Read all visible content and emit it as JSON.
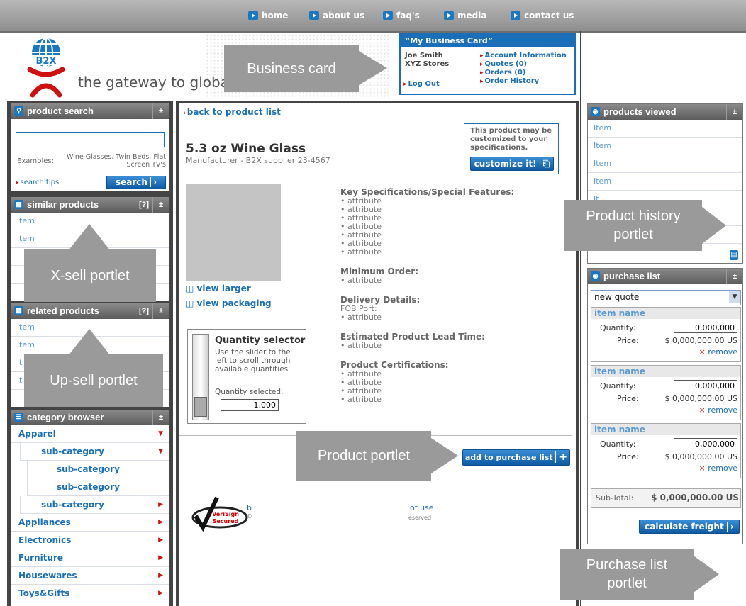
{
  "nav": {
    "items": [
      "home",
      "about us",
      "faq's",
      "media",
      "contact us"
    ]
  },
  "header": {
    "tagline": "the gateway to globa",
    "logo_text": "B2X"
  },
  "business_card": {
    "title": "“My Business Card”",
    "user_name": "Joe Smith",
    "company": "XYZ Stores",
    "logout": "Log Out",
    "links": [
      "Account Information",
      "Quotes (0)",
      "Orders (0)",
      "Order History"
    ]
  },
  "product_search": {
    "title": "product search",
    "examples_label": "Examples:",
    "examples_text": "Wine Glasses, Twin Beds, Flat Screen TV's",
    "tips": "search tips",
    "button": "search"
  },
  "similar_products": {
    "title": "similar products",
    "help": "[?]",
    "items": [
      "item",
      "item",
      "i",
      "i"
    ]
  },
  "related_products": {
    "title": "related products",
    "help": "[?]",
    "items": [
      "item",
      "item",
      "it",
      "it"
    ]
  },
  "category_browser": {
    "title": "category browser",
    "items": [
      {
        "label": "Apparel",
        "level": 0,
        "state": "open"
      },
      {
        "label": "sub-category",
        "level": 1,
        "state": "open"
      },
      {
        "label": "sub-category",
        "level": 2,
        "state": "none"
      },
      {
        "label": "sub-category",
        "level": 2,
        "state": "none"
      },
      {
        "label": "sub-category",
        "level": 1,
        "state": "closed"
      },
      {
        "label": "Appliances",
        "level": 0,
        "state": "closed"
      },
      {
        "label": "Electronics",
        "level": 0,
        "state": "closed"
      },
      {
        "label": "Furniture",
        "level": 0,
        "state": "closed"
      },
      {
        "label": "Housewares",
        "level": 0,
        "state": "closed"
      },
      {
        "label": "Toys&Gifts",
        "level": 0,
        "state": "closed"
      }
    ]
  },
  "product": {
    "back_link": "back to product list",
    "name": "5.3 oz Wine Glass",
    "manufacturer": "Manufacturer - B2X supplier 23-4567",
    "customize_note": "This product may be customized to your specifications.",
    "customize_button": "customize it!",
    "view_larger": "view larger",
    "view_packaging": "view packaging",
    "quantity_title": "Quantity selector",
    "quantity_desc": "Use the slider to the left to scroll through available quantities",
    "quantity_selected_label": "Quantity selected:",
    "quantity_value": "1,000",
    "specs": [
      {
        "heading": "Key Specifications/Special Features:",
        "lines": [
          "• attribute",
          "• attribute",
          "• attribute",
          "• attribute",
          "• attribute",
          "• attribute",
          "• attribute"
        ]
      },
      {
        "heading": "Minimum Order:",
        "lines": [
          "• attribute"
        ]
      },
      {
        "heading": "Delivery Details:",
        "lines": [
          "FOB Port:",
          "• attribute"
        ]
      },
      {
        "heading": "Estimated Product Lead Time:",
        "lines": [
          "• attribute"
        ]
      },
      {
        "heading": "Product Certifications:",
        "lines": [
          "• attribute",
          "• attribute",
          "• attribute",
          "• attribute"
        ]
      }
    ],
    "add_button": "add to purchase list"
  },
  "footer": {
    "text1": "b",
    "text2": "of use",
    "text3": "©",
    "text4": "eserved",
    "verisign": [
      "VeriSign",
      "Secured"
    ]
  },
  "products_viewed": {
    "title": "products viewed",
    "items": [
      "Item",
      "Item",
      "Item",
      "Item",
      "It"
    ]
  },
  "purchase_list": {
    "title": "purchase list",
    "select_value": "new quote",
    "items": [
      {
        "name": "item name",
        "quantity_label": "Quantity:",
        "quantity": "0,000,000",
        "price_label": "Price:",
        "price": "$ 0,000,000.00 US",
        "remove": "remove"
      },
      {
        "name": "item name",
        "quantity_label": "Quantity:",
        "quantity": "0,000,000",
        "price_label": "Price:",
        "price": "$ 0,000,000.00 US",
        "remove": "remove"
      },
      {
        "name": "item name",
        "quantity_label": "Quantity:",
        "quantity": "0,000,000",
        "price_label": "Price:",
        "price": "$ 0,000,000.00 US",
        "remove": "remove"
      }
    ],
    "subtotal_label": "Sub-Total:",
    "subtotal": "$ 0,000,000.00 US",
    "freight_button": "calculate freight"
  },
  "annotations": {
    "business_card": "Business card",
    "xsell": "X-sell portlet",
    "upsell": "Up-sell portlet",
    "product_history": "Product history portlet",
    "product": "Product portlet",
    "purchase_list": "Purchase list portlet"
  },
  "colors": {
    "accent": "#1a6fb8",
    "header_gray": "#8e8e8e",
    "frame": "#444444",
    "annotation": "#9a9a9a",
    "alert": "#d01010"
  }
}
